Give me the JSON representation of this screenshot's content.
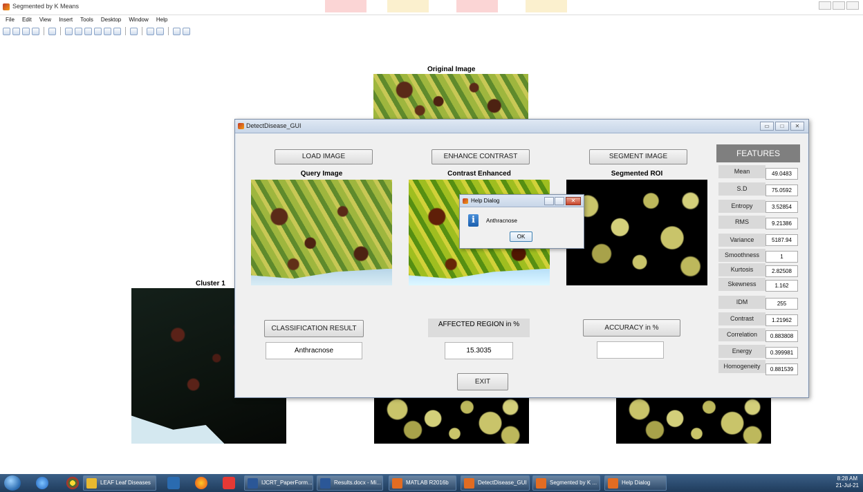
{
  "background_window": {
    "title": "Segmented by K Means",
    "menu": [
      "File",
      "Edit",
      "View",
      "Insert",
      "Tools",
      "Desktop",
      "Window",
      "Help"
    ],
    "original_image_label": "Original Image",
    "cluster_label": "Cluster 1"
  },
  "gui": {
    "title": "DetectDisease_GUI",
    "load_image_label": "LOAD IMAGE",
    "enhance_contrast_label": "ENHANCE CONTRAST",
    "segment_image_label": "SEGMENT IMAGE",
    "query_image_label": "Query Image",
    "contrast_enhanced_label": "Contrast Enhanced",
    "segmented_roi_label": "Segmented ROI",
    "classification_result_label": "CLASSIFICATION RESULT",
    "classification_value": "Anthracnose",
    "affected_region_label": "AFFECTED REGION in %",
    "affected_region_value": "15.3035",
    "accuracy_label": "ACCURACY in %",
    "accuracy_value": "",
    "exit_label": "EXIT",
    "features": {
      "header": "FEATURES",
      "items": [
        {
          "name": "Mean",
          "value": "49.0483"
        },
        {
          "name": "S.D",
          "value": "75.0592"
        },
        {
          "name": "Entropy",
          "value": "3.52854"
        },
        {
          "name": "RMS",
          "value": "9.21386"
        },
        {
          "name": "Variance",
          "value": "5187.94"
        },
        {
          "name": "Smoothness",
          "value": "1"
        },
        {
          "name": "Kurtosis",
          "value": "2.82508"
        },
        {
          "name": "Skewness",
          "value": "1.162"
        },
        {
          "name": "IDM",
          "value": "255"
        },
        {
          "name": "Contrast",
          "value": "1.21962"
        },
        {
          "name": "Correlation",
          "value": "0.883808"
        },
        {
          "name": "Energy",
          "value": "0.399981"
        },
        {
          "name": "Homogeneity",
          "value": "0.881539"
        }
      ]
    }
  },
  "help_dialog": {
    "title": "Help Dialog",
    "message": "Anthracnose",
    "ok_label": "OK"
  },
  "taskbar": {
    "items": [
      {
        "label": "LEAF Leaf Diseases",
        "color": "#e8b930"
      },
      {
        "label": "IJCRT_PaperForm...",
        "color": "#2b5797"
      },
      {
        "label": "Results.docx - Mi...",
        "color": "#2b5797"
      },
      {
        "label": "MATLAB R2016b",
        "color": "#e26c22"
      },
      {
        "label": "DetectDisease_GUI",
        "color": "#e26c22"
      },
      {
        "label": "Segmented by K ...",
        "color": "#e26c22"
      },
      {
        "label": "Help Dialog",
        "color": "#e26c22"
      }
    ],
    "time": "8:28 AM",
    "date": "21-Jul-21"
  }
}
